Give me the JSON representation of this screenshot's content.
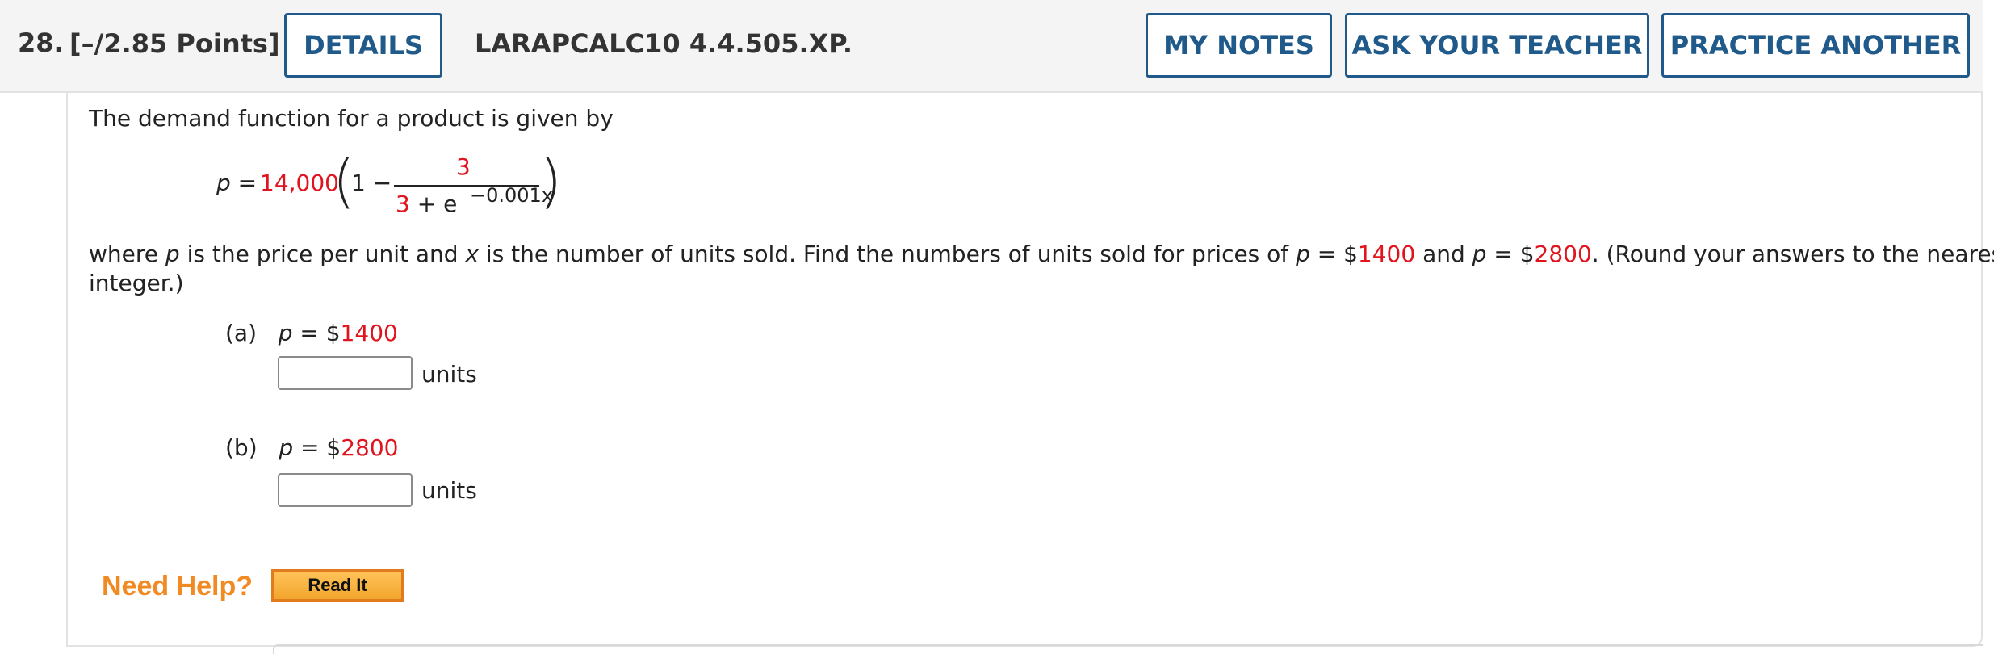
{
  "header": {
    "question_number": "28.",
    "points": "[–/2.85 Points]",
    "details_label": "DETAILS",
    "problem_code": "LARAPCALC10 4.4.505.XP.",
    "my_notes_label": "MY NOTES",
    "ask_teacher_label": "ASK YOUR TEACHER",
    "practice_another_label": "PRACTICE ANOTHER"
  },
  "problem": {
    "intro": "The demand function for a product is given by",
    "formula": {
      "lhs": "p",
      "equals": " = ",
      "constant": "14,000",
      "one_minus": "1 −",
      "numerator": "3",
      "denominator_three": "3",
      "denominator_plus_e": " + e",
      "exponent": "−0.001x"
    },
    "where_parts": {
      "t1": "where ",
      "p": "p",
      "t2": " is the price per unit and ",
      "x": "x",
      "t3": " is the number of units sold. Find the numbers of units sold for prices of ",
      "p2": "p",
      "t4": " = $",
      "price1": "1400",
      "t5": " and ",
      "p3": "p",
      "t6": " = $",
      "price2": "2800",
      "t7": ". (Round your answers to the nearest"
    },
    "where_line2": "integer.)",
    "parts": [
      {
        "label": "(a)",
        "var": "p",
        "eq": " = $",
        "price": "1400",
        "answer_value": "",
        "units": "units"
      },
      {
        "label": "(b)",
        "var": "p",
        "eq": " = $",
        "price": "2800",
        "answer_value": "",
        "units": "units"
      }
    ]
  },
  "help": {
    "need_help_label": "Need Help?",
    "read_it_label": "Read It"
  },
  "colors": {
    "accent_blue": "#1f5a8a",
    "highlight_red": "#e0141e",
    "help_orange": "#f28a24"
  }
}
